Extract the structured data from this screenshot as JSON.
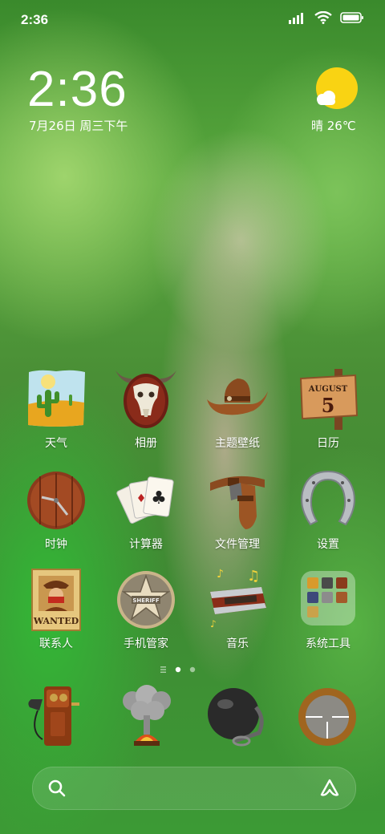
{
  "status_bar": {
    "time": "2:36"
  },
  "clock_widget": {
    "time": "2:36",
    "date": "7月26日 周三下午",
    "weather": "晴 26℃"
  },
  "apps": [
    {
      "label": "天气"
    },
    {
      "label": "相册"
    },
    {
      "label": "主题壁纸"
    },
    {
      "label": "日历",
      "calendar_month": "AUGUST",
      "calendar_day": "5"
    },
    {
      "label": "时钟"
    },
    {
      "label": "计算器"
    },
    {
      "label": "文件管理"
    },
    {
      "label": "设置"
    },
    {
      "label": "联系人",
      "poster_text": "WANTED"
    },
    {
      "label": "手机管家",
      "badge_text": "SHERIFF"
    },
    {
      "label": "音乐"
    },
    {
      "label": "系统工具"
    }
  ],
  "dock": [
    "phone-app",
    "browser-app",
    "camera-app",
    "scope-app"
  ],
  "page_indicator": {
    "pages": 2,
    "active": 1
  },
  "colors": {
    "accent": "#ffffff",
    "sun": "#f9d313"
  }
}
